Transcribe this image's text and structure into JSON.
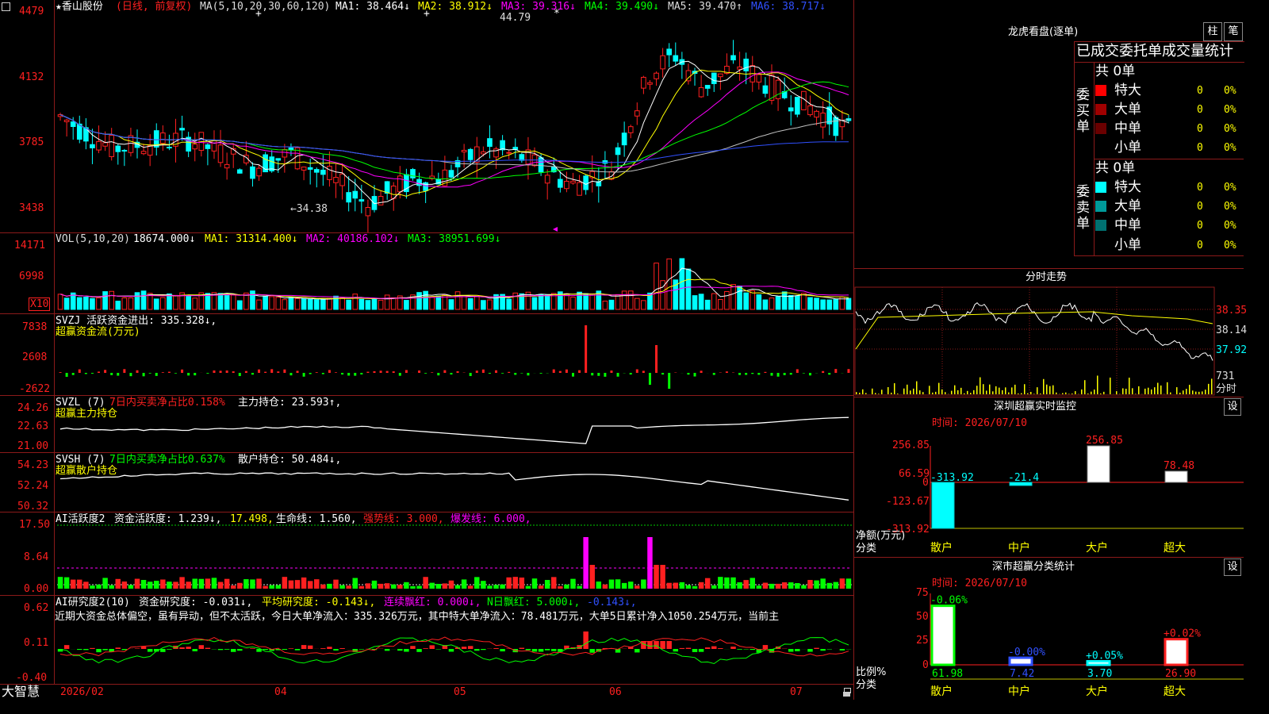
{
  "app": {
    "brand": "大智慧",
    "status_icon": "lock-icon"
  },
  "colors": {
    "up": "#ff2020",
    "down": "#00ffff",
    "bg": "#000000",
    "grid": "#8b1a1a",
    "ma1": "#ffffff",
    "ma2": "#ffff00",
    "ma3": "#ff00ff",
    "ma4": "#00ff00",
    "ma5": "#c0c0c0",
    "ma6": "#3050ff"
  },
  "stock": {
    "name": "★香山股份",
    "mode": "(日线, 前复权)"
  },
  "kline": {
    "ma_header": "MA(5,10,20,30,60,120)",
    "ma1": "MA1: 38.464↓",
    "ma2": "MA2: 38.912↓",
    "ma3": "MA3: 39.316↓",
    "ma4": "MA4: 39.490↓",
    "ma5": "MA5: 39.470↑",
    "ma6": "MA6: 38.717↓",
    "y_ticks": [
      "4479",
      "4132",
      "3785",
      "3438"
    ],
    "high_note": "44.79",
    "low_note": "←34.38",
    "marks": [
      "+",
      "+",
      "*"
    ]
  },
  "vol": {
    "header": "VOL(5,10,20)",
    "value": "18674.000↓",
    "ma1": "MA1: 31314.400↓",
    "ma2": "MA2: 40186.102↓",
    "ma3": "MA3: 38951.699↓",
    "y_ticks": [
      "14171",
      "6998"
    ],
    "unit": "X10"
  },
  "svzj": {
    "header": "SVZJ  活跃资金进出: 335.328↓,",
    "subtitle": "超赢资金流(万元)",
    "y_ticks": [
      "7838",
      "2608",
      "-2622"
    ]
  },
  "svzl": {
    "header": "SVZL (7)",
    "ratio": "7日内买卖净占比0.158%",
    "hold": "主力持仓: 23.593↑,",
    "subtitle": "超赢主力持仓",
    "y_ticks": [
      "24.26",
      "22.63",
      "21.00"
    ]
  },
  "svsh": {
    "header": "SVSH (7)",
    "ratio": "7日内买卖净占比0.637%",
    "hold": "散户持仓: 50.484↓,",
    "subtitle": "超赢散户持仓",
    "y_ticks": [
      "54.23",
      "52.24",
      "50.32"
    ]
  },
  "ai1": {
    "header": "AI活跃度2",
    "a": "资金活跃度: 1.239↓,",
    "b": "17.498,",
    "c": "生命线: 1.560,",
    "d": "强势线: 3.000,",
    "e": "爆发线: 6.000,",
    "y_ticks": [
      "17.50",
      "8.64",
      "0.00"
    ]
  },
  "ai2": {
    "header": "AI研究度2(10)",
    "a": "资金研究度: -0.031↓,",
    "b": "平均研究度: -0.143↓,",
    "c": "连续飘红: 0.000↓,",
    "d": "N日飘红: 5.000↓,",
    "e": "-0.143↓,",
    "comment": "近期大资金总体偏空，虽有异动，但不太活跃，今日大单净流入：335.326万元，其中特大单净流入：78.481万元，大单5日累计净入1050.254万元，当前主",
    "y_ticks": [
      "0.62",
      "0.11",
      "-0.40"
    ]
  },
  "x_axis": [
    "2026/02",
    "04",
    "05",
    "06",
    "07"
  ],
  "right": {
    "title": "龙虎看盘(逐单)",
    "btn_bar": "柱",
    "btn_pen": "笔",
    "tabs": [
      "已成交",
      "委托单",
      "成交量",
      "统计"
    ],
    "buy_label": "委买单",
    "sell_label": "委卖单",
    "buy_total": "共 0单",
    "sell_total": "共 0单",
    "buy_rows": [
      {
        "label": "特大",
        "count": "0",
        "pct": "0%"
      },
      {
        "label": "大单",
        "count": "0",
        "pct": "0%"
      },
      {
        "label": "中单",
        "count": "0",
        "pct": "0%"
      },
      {
        "label": "小单",
        "count": "0",
        "pct": "0%"
      }
    ],
    "sell_rows": [
      {
        "label": "特大",
        "count": "0",
        "pct": "0%"
      },
      {
        "label": "大单",
        "count": "0",
        "pct": "0%"
      },
      {
        "label": "中单",
        "count": "0",
        "pct": "0%"
      },
      {
        "label": "小单",
        "count": "0",
        "pct": "0%"
      }
    ],
    "intraday_title": "分时走势",
    "intraday_prices": [
      "38.35",
      "38.14",
      "37.92"
    ],
    "intraday_vol": "731",
    "intraday_unit": "分时",
    "monitor_title": "深圳超赢实时监控",
    "monitor_time": "时间: 2026/07/10",
    "monitor_settings": "设",
    "monitor_y": [
      "256.85",
      "66.59",
      "0",
      "-123.67",
      "-313.92"
    ],
    "monitor_ylabel": "净额(万元)",
    "monitor_xlabel": "分类",
    "stats_title": "深市超赢分类统计",
    "stats_time": "时间: 2026/07/10",
    "stats_settings": "设",
    "stats_y": [
      "75",
      "50",
      "25",
      "0"
    ],
    "stats_ylabel": "比例%",
    "stats_xlabel": "分类"
  },
  "chart_data": [
    {
      "type": "bar",
      "title": "深圳超赢实时监控",
      "ylabel": "净额(万元)",
      "xlabel": "分类",
      "categories": [
        "散户",
        "中户",
        "大户",
        "超大"
      ],
      "values": [
        -313.92,
        -21.4,
        256.85,
        78.48
      ],
      "labels": [
        "-313.92",
        "-21.4",
        "256.85",
        "78.48"
      ],
      "ylim": [
        -313.92,
        256.85
      ]
    },
    {
      "type": "bar",
      "title": "深市超赢分类统计",
      "ylabel": "比例%",
      "xlabel": "分类",
      "categories": [
        "散户",
        "中户",
        "大户",
        "超大"
      ],
      "values": [
        61.98,
        7.42,
        3.7,
        26.9
      ],
      "changes": [
        "-0.06%",
        "-0.00%",
        "+0.05%",
        "+0.02%"
      ],
      "value_labels": [
        "61.98",
        "7.42",
        "3.70",
        "26.90"
      ],
      "ylim": [
        0,
        75
      ]
    }
  ]
}
